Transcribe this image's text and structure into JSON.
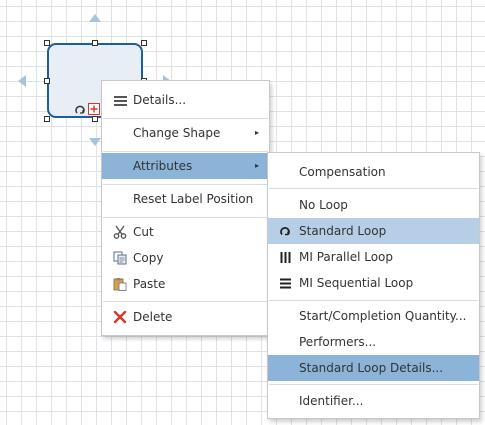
{
  "context_menu": {
    "items": [
      {
        "label": "Details...",
        "icon": "list-icon"
      },
      {
        "label": "Change Shape",
        "submenu": "▸"
      },
      {
        "label": "Attributes",
        "submenu": "▸"
      },
      {
        "label": "Reset Label Position"
      },
      {
        "label": "Cut",
        "icon": "scissors-icon"
      },
      {
        "label": "Copy",
        "icon": "copy-icon"
      },
      {
        "label": "Paste",
        "icon": "paste-icon"
      },
      {
        "label": "Delete",
        "icon": "delete-x-icon"
      }
    ]
  },
  "attributes_submenu": {
    "items": [
      {
        "label": "Compensation"
      },
      {
        "label": "No Loop"
      },
      {
        "label": "Standard Loop",
        "icon": "standard-loop-icon",
        "state": "selected"
      },
      {
        "label": "MI Parallel Loop",
        "icon": "parallel-bars-icon"
      },
      {
        "label": "MI Sequential Loop",
        "icon": "sequential-bars-icon"
      },
      {
        "label": "Start/Completion Quantity..."
      },
      {
        "label": "Performers..."
      },
      {
        "label": "Standard Loop Details...",
        "state": "hover"
      },
      {
        "label": "Identifier..."
      }
    ]
  },
  "colors": {
    "shape_border": "#1f5d98",
    "shape_fill": "#e8eef6",
    "menu_hover": "#8cb4d9",
    "menu_selected": "#b7cfe6",
    "delete_red": "#d9342b"
  }
}
